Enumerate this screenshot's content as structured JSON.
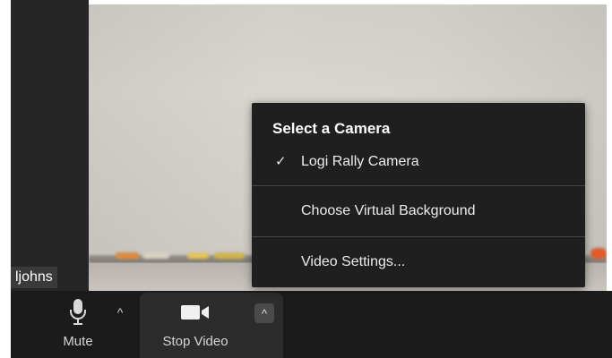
{
  "participant": {
    "name": "ljohns"
  },
  "toolbar": {
    "mute_label": "Mute",
    "stop_video_label": "Stop Video",
    "caret_glyph": "^"
  },
  "camera_menu": {
    "header": "Select a Camera",
    "items": [
      {
        "label": "Logi Rally Camera",
        "checked": true,
        "check_glyph": "✓"
      },
      {
        "label": "Choose Virtual Background",
        "checked": false
      },
      {
        "label": "Video Settings...",
        "checked": false
      }
    ]
  },
  "icons": {
    "mute": "microphone-icon",
    "stop_video": "video-camera-icon",
    "caret": "chevron-up-icon",
    "check": "checkmark-icon"
  },
  "colors": {
    "toolbar_bg": "#1b1b1b",
    "popup_bg": "#1f1f1f",
    "active_button_bg": "#2c2c2c"
  }
}
